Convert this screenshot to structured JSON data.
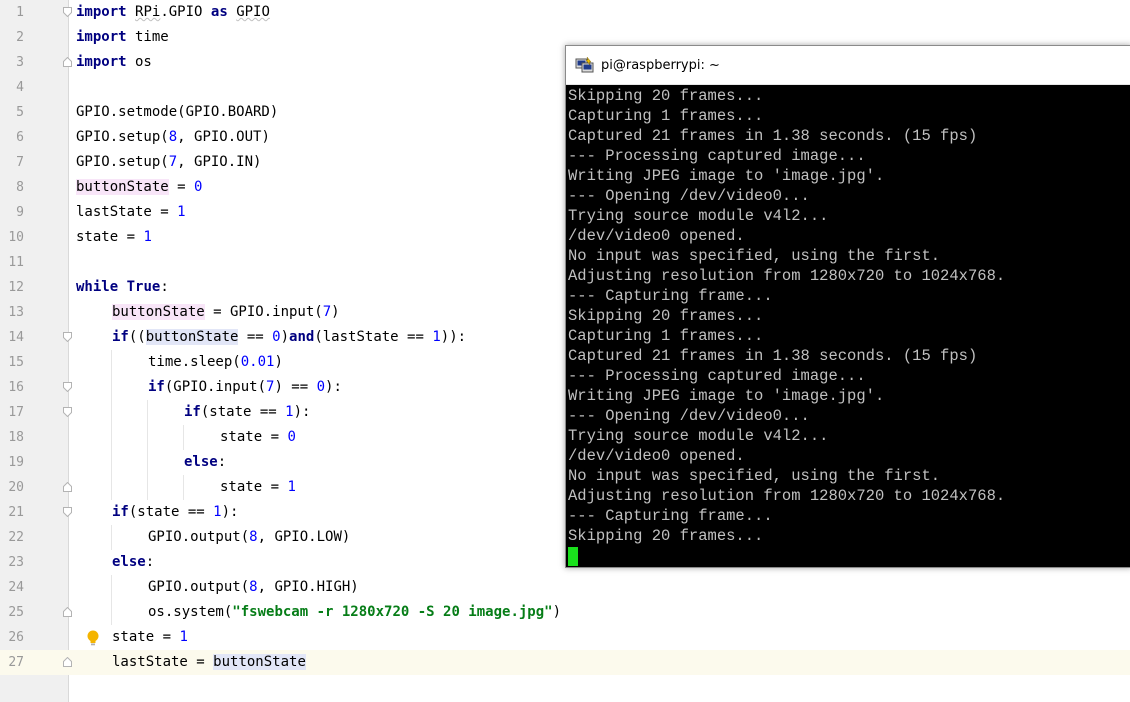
{
  "editor": {
    "current_line": 27,
    "lines": [
      {
        "n": "1",
        "indent": 0,
        "parts": [
          {
            "t": "import",
            "c": "kw"
          },
          {
            "t": " "
          },
          {
            "t": "RPi",
            "c": "squig"
          },
          {
            "t": ".GPIO "
          },
          {
            "t": "as",
            "c": "kw"
          },
          {
            "t": " "
          },
          {
            "t": "GPIO",
            "c": "squig"
          }
        ]
      },
      {
        "n": "2",
        "indent": 0,
        "parts": [
          {
            "t": "import",
            "c": "kw"
          },
          {
            "t": " time"
          }
        ]
      },
      {
        "n": "3",
        "indent": 0,
        "parts": [
          {
            "t": "import",
            "c": "kw"
          },
          {
            "t": " os"
          }
        ]
      },
      {
        "n": "4",
        "indent": 0,
        "parts": []
      },
      {
        "n": "5",
        "indent": 0,
        "parts": [
          {
            "t": "GPIO.setmode(GPIO.BOARD)"
          }
        ]
      },
      {
        "n": "6",
        "indent": 0,
        "parts": [
          {
            "t": "GPIO.setup("
          },
          {
            "t": "8",
            "c": "num"
          },
          {
            "t": ", GPIO.OUT)"
          }
        ]
      },
      {
        "n": "7",
        "indent": 0,
        "parts": [
          {
            "t": "GPIO.setup("
          },
          {
            "t": "7",
            "c": "num"
          },
          {
            "t": ", GPIO.IN)"
          }
        ]
      },
      {
        "n": "8",
        "indent": 0,
        "parts": [
          {
            "t": "buttonState",
            "c": "pink"
          },
          {
            "t": " = "
          },
          {
            "t": "0",
            "c": "num"
          }
        ]
      },
      {
        "n": "9",
        "indent": 0,
        "parts": [
          {
            "t": "lastState = "
          },
          {
            "t": "1",
            "c": "num"
          }
        ]
      },
      {
        "n": "10",
        "indent": 0,
        "parts": [
          {
            "t": "state = "
          },
          {
            "t": "1",
            "c": "num"
          }
        ]
      },
      {
        "n": "11",
        "indent": 0,
        "parts": []
      },
      {
        "n": "12",
        "indent": 0,
        "parts": [
          {
            "t": "while",
            "c": "kw"
          },
          {
            "t": " "
          },
          {
            "t": "True",
            "c": "kw"
          },
          {
            "t": ":"
          }
        ]
      },
      {
        "n": "13",
        "indent": 1,
        "parts": [
          {
            "t": "buttonState",
            "c": "pink"
          },
          {
            "t": " = GPIO.input("
          },
          {
            "t": "7",
            "c": "num"
          },
          {
            "t": ")"
          }
        ]
      },
      {
        "n": "14",
        "indent": 1,
        "parts": [
          {
            "t": "if",
            "c": "kw"
          },
          {
            "t": "(("
          },
          {
            "t": "buttonState",
            "c": "hl"
          },
          {
            "t": " == "
          },
          {
            "t": "0",
            "c": "num"
          },
          {
            "t": ")"
          },
          {
            "t": "and",
            "c": "kw"
          },
          {
            "t": "(lastState == "
          },
          {
            "t": "1",
            "c": "num"
          },
          {
            "t": ")):"
          }
        ]
      },
      {
        "n": "15",
        "indent": 2,
        "parts": [
          {
            "t": "time.sleep("
          },
          {
            "t": "0.01",
            "c": "num"
          },
          {
            "t": ")"
          }
        ]
      },
      {
        "n": "16",
        "indent": 2,
        "parts": [
          {
            "t": "if",
            "c": "kw"
          },
          {
            "t": "(GPIO.input("
          },
          {
            "t": "7",
            "c": "num"
          },
          {
            "t": ") == "
          },
          {
            "t": "0",
            "c": "num"
          },
          {
            "t": "):"
          }
        ]
      },
      {
        "n": "17",
        "indent": 3,
        "parts": [
          {
            "t": "if",
            "c": "kw"
          },
          {
            "t": "(state == "
          },
          {
            "t": "1",
            "c": "num"
          },
          {
            "t": "):"
          }
        ]
      },
      {
        "n": "18",
        "indent": 4,
        "parts": [
          {
            "t": "state = "
          },
          {
            "t": "0",
            "c": "num"
          }
        ]
      },
      {
        "n": "19",
        "indent": 3,
        "parts": [
          {
            "t": "else",
            "c": "kw"
          },
          {
            "t": ":"
          }
        ]
      },
      {
        "n": "20",
        "indent": 4,
        "parts": [
          {
            "t": "state = "
          },
          {
            "t": "1",
            "c": "num"
          }
        ]
      },
      {
        "n": "21",
        "indent": 1,
        "parts": [
          {
            "t": "if",
            "c": "kw"
          },
          {
            "t": "(state == "
          },
          {
            "t": "1",
            "c": "num"
          },
          {
            "t": "):"
          }
        ]
      },
      {
        "n": "22",
        "indent": 2,
        "parts": [
          {
            "t": "GPIO.output("
          },
          {
            "t": "8",
            "c": "num"
          },
          {
            "t": ", GPIO.LOW)"
          }
        ]
      },
      {
        "n": "23",
        "indent": 1,
        "parts": [
          {
            "t": "else",
            "c": "kw"
          },
          {
            "t": ":"
          }
        ]
      },
      {
        "n": "24",
        "indent": 2,
        "parts": [
          {
            "t": "GPIO.output("
          },
          {
            "t": "8",
            "c": "num"
          },
          {
            "t": ", GPIO.HIGH)"
          }
        ]
      },
      {
        "n": "25",
        "indent": 2,
        "parts": [
          {
            "t": "os.system("
          },
          {
            "t": "\"fswebcam -r 1280x720 -S 20 image.jpg\"",
            "c": "str"
          },
          {
            "t": ")"
          }
        ]
      },
      {
        "n": "26",
        "indent": 1,
        "parts": [
          {
            "t": "state = "
          },
          {
            "t": "1",
            "c": "num"
          }
        ]
      },
      {
        "n": "27",
        "indent": 1,
        "parts": [
          {
            "t": "lastState = "
          },
          {
            "t": "buttonState",
            "c": "hl"
          }
        ]
      }
    ],
    "fold_markers": [
      {
        "line": 1,
        "kind": "start"
      },
      {
        "line": 3,
        "kind": "end"
      },
      {
        "line": 14,
        "kind": "start"
      },
      {
        "line": 16,
        "kind": "start"
      },
      {
        "line": 17,
        "kind": "start"
      },
      {
        "line": 20,
        "kind": "end"
      },
      {
        "line": 21,
        "kind": "start"
      },
      {
        "line": 25,
        "kind": "end"
      },
      {
        "line": 27,
        "kind": "end"
      }
    ],
    "intention_icon": "lightbulb-icon"
  },
  "terminal": {
    "title": "pi@raspberrypi: ~",
    "icon": "putty-icon",
    "lines": [
      "Skipping 20 frames...",
      "Capturing 1 frames...",
      "Captured 21 frames in 1.38 seconds. (15 fps)",
      "--- Processing captured image...",
      "Writing JPEG image to 'image.jpg'.",
      "--- Opening /dev/video0...",
      "Trying source module v4l2...",
      "/dev/video0 opened.",
      "No input was specified, using the first.",
      "Adjusting resolution from 1280x720 to 1024x768.",
      "--- Capturing frame...",
      "Skipping 20 frames...",
      "Capturing 1 frames...",
      "Captured 21 frames in 1.38 seconds. (15 fps)",
      "--- Processing captured image...",
      "Writing JPEG image to 'image.jpg'.",
      "--- Opening /dev/video0...",
      "Trying source module v4l2...",
      "/dev/video0 opened.",
      "No input was specified, using the first.",
      "Adjusting resolution from 1280x720 to 1024x768.",
      "--- Capturing frame...",
      "Skipping 20 frames..."
    ],
    "cursor_color": "#19e01c",
    "foreground": "#c0c0c0",
    "background": "#000000"
  }
}
